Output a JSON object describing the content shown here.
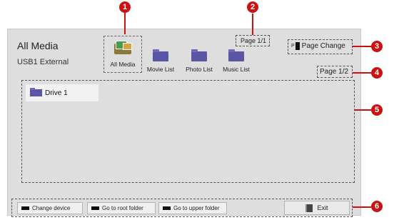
{
  "header": {
    "title": "All Media",
    "subtitle": "USB1 External"
  },
  "categories": [
    {
      "label": "All Media",
      "icon": "all-media-icon",
      "selected": true
    },
    {
      "label": "Movie List",
      "icon": "folder-icon",
      "selected": false
    },
    {
      "label": "Photo List",
      "icon": "folder-icon",
      "selected": false
    },
    {
      "label": "Music List",
      "icon": "folder-icon",
      "selected": false
    }
  ],
  "page_top": "Page 1/1",
  "page_change": "Page Change",
  "page_change_icon": "p-key-icon",
  "page_list": "Page 1/2",
  "content": {
    "drive_label": "Drive 1",
    "drive_icon": "folder-icon"
  },
  "footer": {
    "buttons": [
      "Change device",
      "Go to root folder",
      "Go to upper folder"
    ],
    "exit_label": "Exit",
    "exit_icon": "door-icon"
  },
  "callouts": [
    "1",
    "2",
    "3",
    "4",
    "5",
    "6"
  ],
  "colors": {
    "background": "#dedede",
    "folder": "#5a55a4",
    "callout": "#cc1111"
  }
}
